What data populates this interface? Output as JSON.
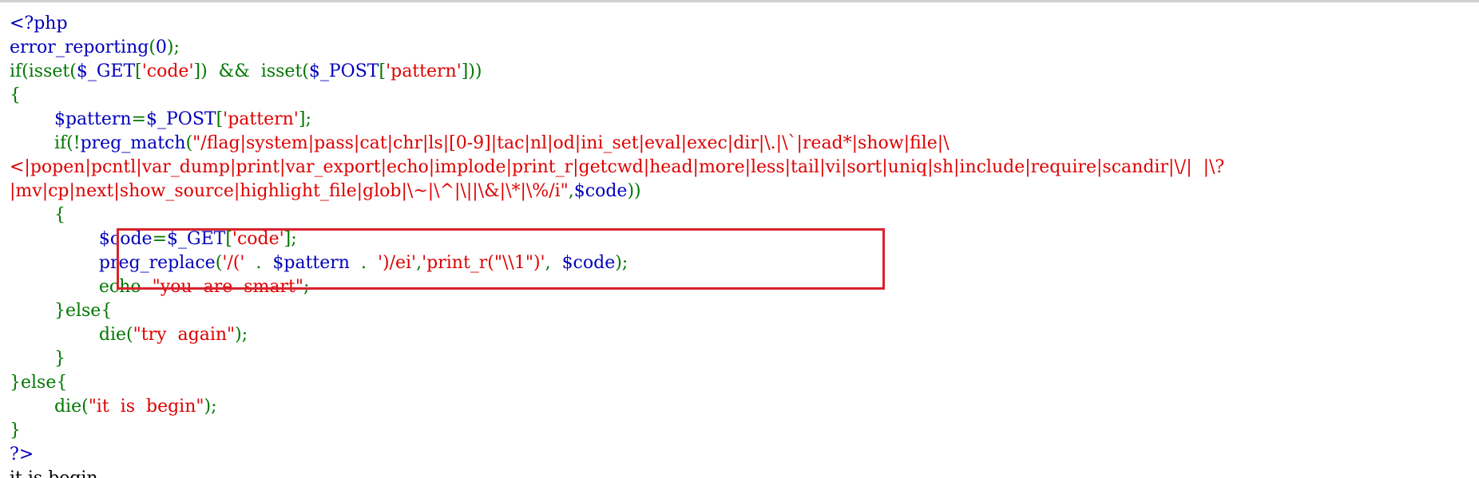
{
  "colors": {
    "keyword": "#007700",
    "default": "#0000bb",
    "string": "#dd0000",
    "plain": "#000000",
    "highlight_border": "#d9232d"
  },
  "code_lines": [
    [
      {
        "text": "<?php",
        "t": "default"
      }
    ],
    [
      {
        "text": "error_reporting",
        "t": "default"
      },
      {
        "text": "(",
        "t": "keyword"
      },
      {
        "text": "0",
        "t": "default"
      },
      {
        "text": ");",
        "t": "keyword"
      }
    ],
    [
      {
        "text": "if(isset(",
        "t": "keyword"
      },
      {
        "text": "$_GET",
        "t": "default"
      },
      {
        "text": "[",
        "t": "keyword"
      },
      {
        "text": "'code'",
        "t": "string"
      },
      {
        "text": "])  &&  isset(",
        "t": "keyword"
      },
      {
        "text": "$_POST",
        "t": "default"
      },
      {
        "text": "[",
        "t": "keyword"
      },
      {
        "text": "'pattern'",
        "t": "string"
      },
      {
        "text": "]))",
        "t": "keyword"
      }
    ],
    [
      {
        "text": "{",
        "t": "keyword"
      }
    ],
    [
      {
        "text": "\t",
        "t": "keyword"
      },
      {
        "text": "$pattern",
        "t": "default"
      },
      {
        "text": "=",
        "t": "keyword"
      },
      {
        "text": "$_POST",
        "t": "default"
      },
      {
        "text": "[",
        "t": "keyword"
      },
      {
        "text": "'pattern'",
        "t": "string"
      },
      {
        "text": "];",
        "t": "keyword"
      }
    ],
    [
      {
        "text": "\tif(!",
        "t": "keyword"
      },
      {
        "text": "preg_match",
        "t": "default"
      },
      {
        "text": "(",
        "t": "keyword"
      },
      {
        "text": "\"/flag|system|pass|cat|chr|ls|[0-9]|tac|nl|od|ini_set|eval|exec|dir|\\.|\\`|read*|show|file|\\",
        "t": "string"
      }
    ],
    [
      {
        "text": "<|popen|pcntl|var_dump|print|var_export|echo|implode|print_r|getcwd|head|more|less|tail|vi|sort|uniq|sh|include|require|scandir|\\/|  |\\?",
        "t": "string"
      }
    ],
    [
      {
        "text": "|mv|cp|next|show_source|highlight_file|glob|\\~|\\^|\\||\\&|\\*|\\%/i\"",
        "t": "string"
      },
      {
        "text": ",",
        "t": "keyword"
      },
      {
        "text": "$code",
        "t": "default"
      },
      {
        "text": "))",
        "t": "keyword"
      }
    ],
    [
      {
        "text": "\t{",
        "t": "keyword"
      }
    ],
    [
      {
        "text": "\t\t",
        "t": "keyword"
      },
      {
        "text": "$code",
        "t": "default"
      },
      {
        "text": "=",
        "t": "keyword"
      },
      {
        "text": "$_GET",
        "t": "default"
      },
      {
        "text": "[",
        "t": "keyword"
      },
      {
        "text": "'code'",
        "t": "string"
      },
      {
        "text": "];",
        "t": "keyword"
      }
    ],
    [
      {
        "text": "\t\t",
        "t": "keyword"
      },
      {
        "text": "preg_replace",
        "t": "default"
      },
      {
        "text": "(",
        "t": "keyword"
      },
      {
        "text": "'/('  ",
        "t": "string"
      },
      {
        "text": ".  ",
        "t": "keyword"
      },
      {
        "text": "$pattern  ",
        "t": "default"
      },
      {
        "text": ".  ",
        "t": "keyword"
      },
      {
        "text": "')/ei'",
        "t": "string"
      },
      {
        "text": ",",
        "t": "keyword"
      },
      {
        "text": "'print_r(\"\\\\1\")'",
        "t": "string"
      },
      {
        "text": ",  ",
        "t": "keyword"
      },
      {
        "text": "$code",
        "t": "default"
      },
      {
        "text": ");",
        "t": "keyword"
      }
    ],
    [
      {
        "text": "\t\techo  ",
        "t": "keyword"
      },
      {
        "text": "\"you  are  smart\"",
        "t": "string"
      },
      {
        "text": ";",
        "t": "keyword"
      }
    ],
    [
      {
        "text": "\t}else{",
        "t": "keyword"
      }
    ],
    [
      {
        "text": "\t\tdie(",
        "t": "keyword"
      },
      {
        "text": "\"try  again\"",
        "t": "string"
      },
      {
        "text": ");",
        "t": "keyword"
      }
    ],
    [
      {
        "text": "\t}",
        "t": "keyword"
      }
    ],
    [
      {
        "text": "}else{",
        "t": "keyword"
      }
    ],
    [
      {
        "text": "\tdie(",
        "t": "keyword"
      },
      {
        "text": "\"it  is  begin\"",
        "t": "string"
      },
      {
        "text": ");",
        "t": "keyword"
      }
    ],
    [
      {
        "text": "}",
        "t": "keyword"
      }
    ],
    [
      {
        "text": "?>",
        "t": "default"
      }
    ],
    [
      {
        "text": "it is begin",
        "t": "plain"
      }
    ]
  ]
}
